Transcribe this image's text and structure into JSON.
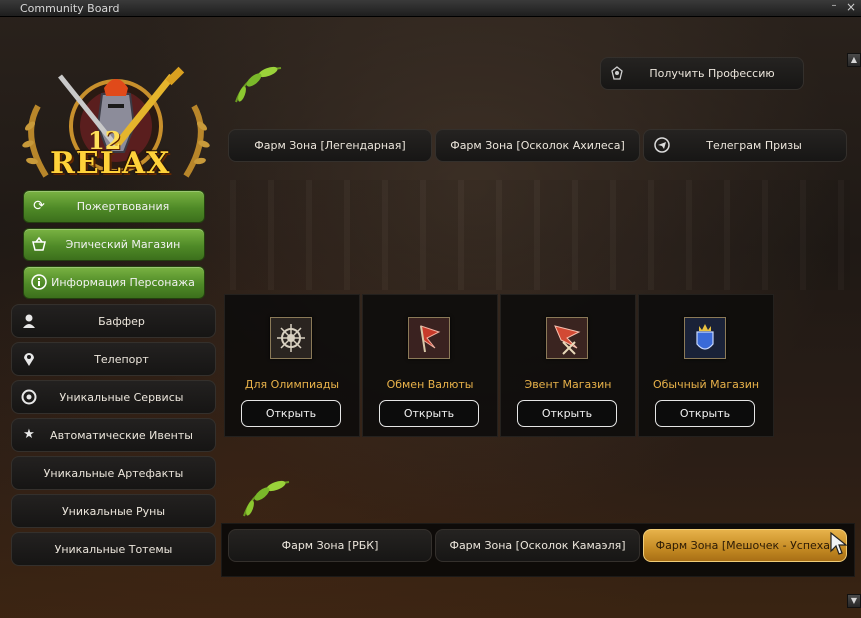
{
  "window": {
    "title": "Community Board",
    "minimize": "–",
    "close": "×"
  },
  "logo": {
    "number": "12",
    "word": "RELAX"
  },
  "green_menu": [
    {
      "icon": "refresh-icon",
      "label": "Пожертвования"
    },
    {
      "icon": "basket-icon",
      "label": "Эпический Магазин"
    },
    {
      "icon": "info-icon",
      "label": "Информация Персонажа"
    }
  ],
  "side_menu": [
    {
      "icon": "person-icon",
      "label": "Баффер"
    },
    {
      "icon": "location-pin-icon",
      "label": "Телепорт"
    },
    {
      "icon": "services-icon",
      "label": "Уникальные Сервисы"
    },
    {
      "icon": "star-icon",
      "label": "Автоматические Ивенты"
    },
    {
      "icon": "",
      "label": "Уникальные Артефакты"
    },
    {
      "icon": "",
      "label": "Уникальные Руны"
    },
    {
      "icon": "",
      "label": "Уникальные Тотемы"
    }
  ],
  "profession_button": {
    "icon": "crest-icon",
    "label": "Получить Профессию"
  },
  "top_buttons": [
    {
      "label": "Фарм Зона [Легендарная]"
    },
    {
      "label": "Фарм Зона [Осколок Ахилеса]"
    },
    {
      "icon": "telegram-icon",
      "label": "Телеграм Призы"
    }
  ],
  "shops": [
    {
      "icon": "olympiad-emblem-icon",
      "name": "Для Олимпиады",
      "button": "Открыть"
    },
    {
      "icon": "currency-flag-icon",
      "name": "Обмен Валюты",
      "button": "Открыть"
    },
    {
      "icon": "event-flag-icon",
      "name": "Эвент Магазин",
      "button": "Открыть"
    },
    {
      "icon": "shield-crown-icon",
      "name": "Обычный Магазин",
      "button": "Открыть"
    }
  ],
  "bottom_buttons": [
    {
      "label": "Фарм Зона [РБК]",
      "active": false
    },
    {
      "label": "Фарм Зона [Осколок Камаэля]",
      "active": false
    },
    {
      "label": "Фарм Зона [Мешочек - Успеха]",
      "active": true
    }
  ],
  "scroll": {
    "up": "▲",
    "down": "▼"
  },
  "colors": {
    "green": "#5a9a2e",
    "gold": "#e9b24a",
    "active_gold": "#d39a30"
  }
}
